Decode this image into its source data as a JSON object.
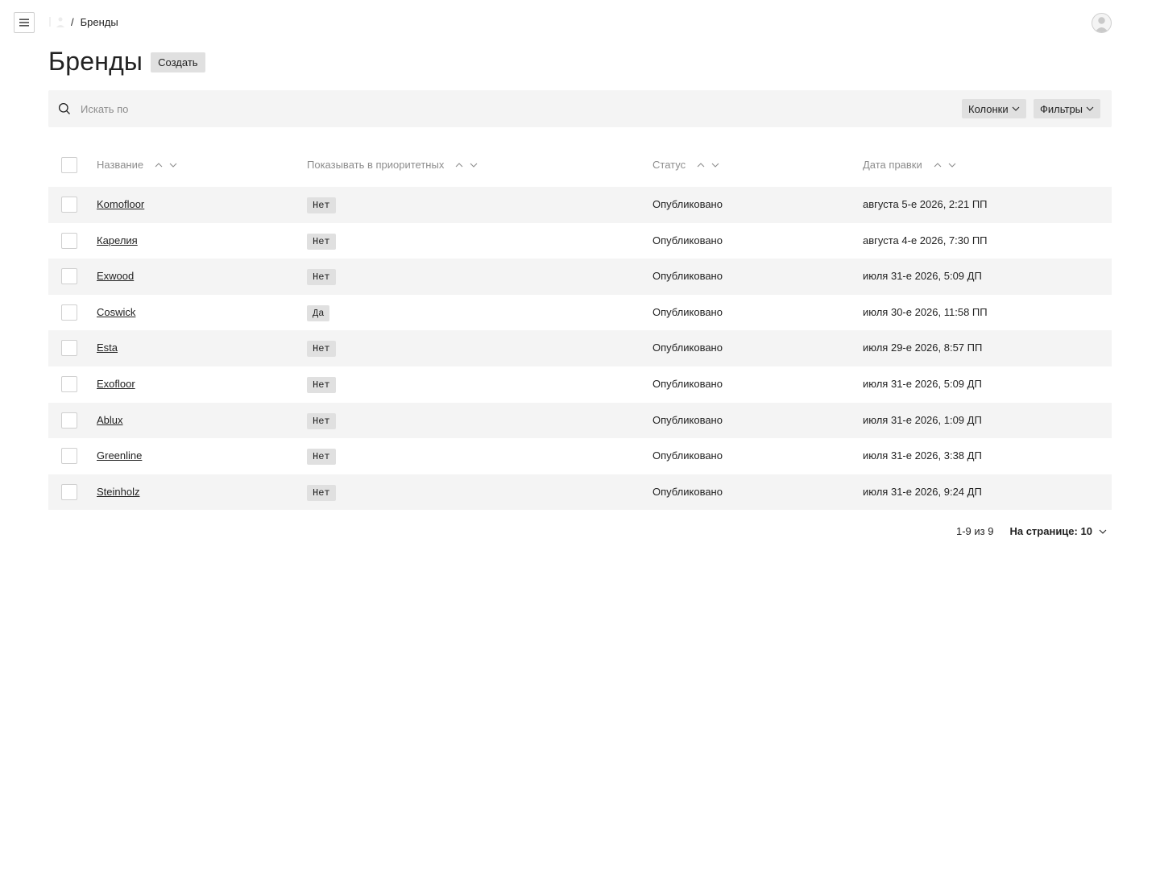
{
  "nav": {
    "menu_icon": "hamburger-icon",
    "home_icon": "home-icon",
    "separator": "/",
    "current": "Бренды",
    "avatar_icon": "user-avatar-icon"
  },
  "header": {
    "title": "Бренды",
    "create_label": "Создать"
  },
  "search": {
    "icon": "search-icon",
    "placeholder": "Искать по",
    "value": "",
    "columns_label": "Колонки",
    "filters_label": "Фильтры"
  },
  "table": {
    "columns": [
      "Название",
      "Показывать в приоритетных",
      "Статус",
      "Дата правки"
    ],
    "rows": [
      {
        "name": "Komofloor",
        "priority": "Нет",
        "status": "Опубликовано",
        "date": "августа 5-е 2026, 2:21 ПП"
      },
      {
        "name": "Карелия",
        "priority": "Нет",
        "status": "Опубликовано",
        "date": "августа 4-е 2026, 7:30 ПП"
      },
      {
        "name": "Exwood",
        "priority": "Нет",
        "status": "Опубликовано",
        "date": "июля 31-е 2026, 5:09 ДП"
      },
      {
        "name": "Coswick",
        "priority": "Да",
        "status": "Опубликовано",
        "date": "июля 30-е 2026, 11:58 ПП"
      },
      {
        "name": "Esta",
        "priority": "Нет",
        "status": "Опубликовано",
        "date": "июля 29-е 2026, 8:57 ПП"
      },
      {
        "name": "Exofloor",
        "priority": "Нет",
        "status": "Опубликовано",
        "date": "июля 31-е 2026, 5:09 ДП"
      },
      {
        "name": "Ablux",
        "priority": "Нет",
        "status": "Опубликовано",
        "date": "июля 31-е 2026, 1:09 ДП"
      },
      {
        "name": "Greenline",
        "priority": "Нет",
        "status": "Опубликовано",
        "date": "июля 31-е 2026, 3:38 ДП"
      },
      {
        "name": "Steinholz",
        "priority": "Нет",
        "status": "Опубликовано",
        "date": "июля 31-е 2026, 9:24 ДП"
      }
    ]
  },
  "pagination": {
    "range": "1-9 из 9",
    "per_page_label": "На странице: 10"
  },
  "colors": {
    "page_bg": "#ffffff",
    "stripe_bg": "#f4f4f4",
    "button_bg": "#e0e0e0",
    "text": "#222222",
    "muted_text": "#8d8d8d",
    "border": "#cfcfcf"
  }
}
